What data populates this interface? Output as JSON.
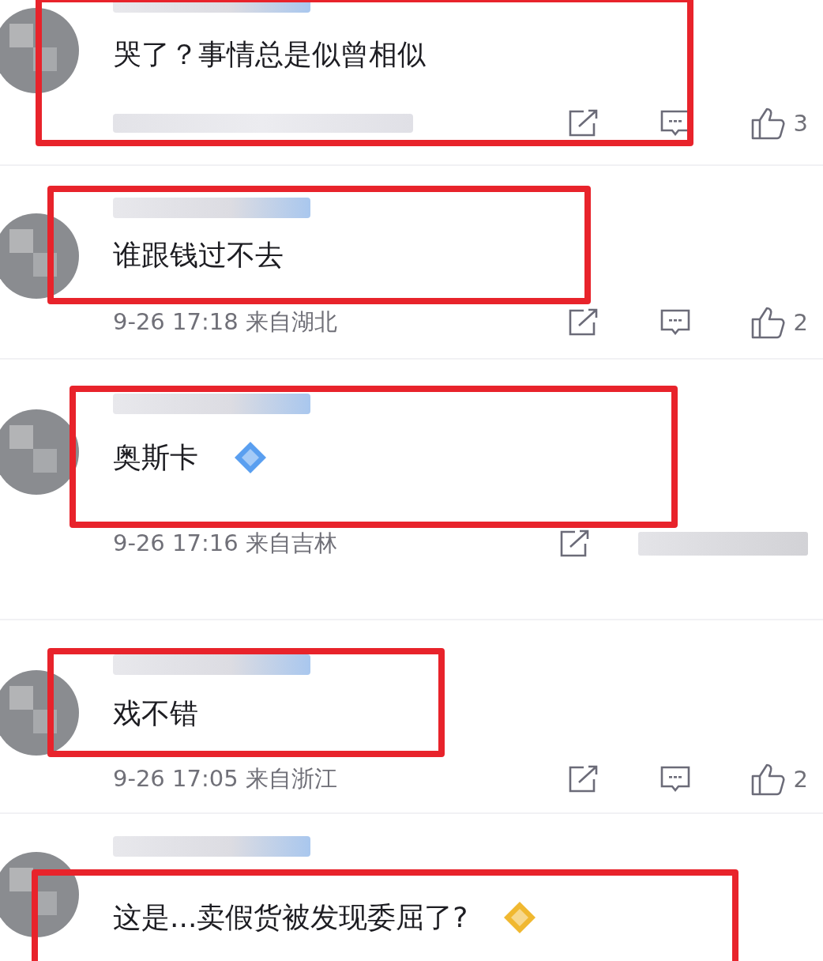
{
  "comments": [
    {
      "text": "哭了？事情总是似曾相似",
      "footer_visible": true,
      "likes": "3",
      "highlighted": true
    },
    {
      "text": "谁跟钱过不去",
      "meta": "9-26 17:18 来自湖北",
      "footer_visible": true,
      "likes": "2",
      "highlighted": true
    },
    {
      "text": "奥斯卡",
      "meta": "9-26 17:16 来自吉林",
      "footer_visible": true,
      "actions_blurred": true,
      "highlighted": true,
      "sticker": {
        "color": "#5a9ff0"
      }
    },
    {
      "text": "戏不错",
      "meta": "9-26 17:05 来自浙江",
      "footer_visible": true,
      "likes": "2",
      "highlighted": true
    },
    {
      "text": "这是...卖假货被发现委屈了?",
      "footer_visible": false,
      "highlighted": true,
      "sticker": {
        "color": "#f0b830"
      }
    }
  ]
}
